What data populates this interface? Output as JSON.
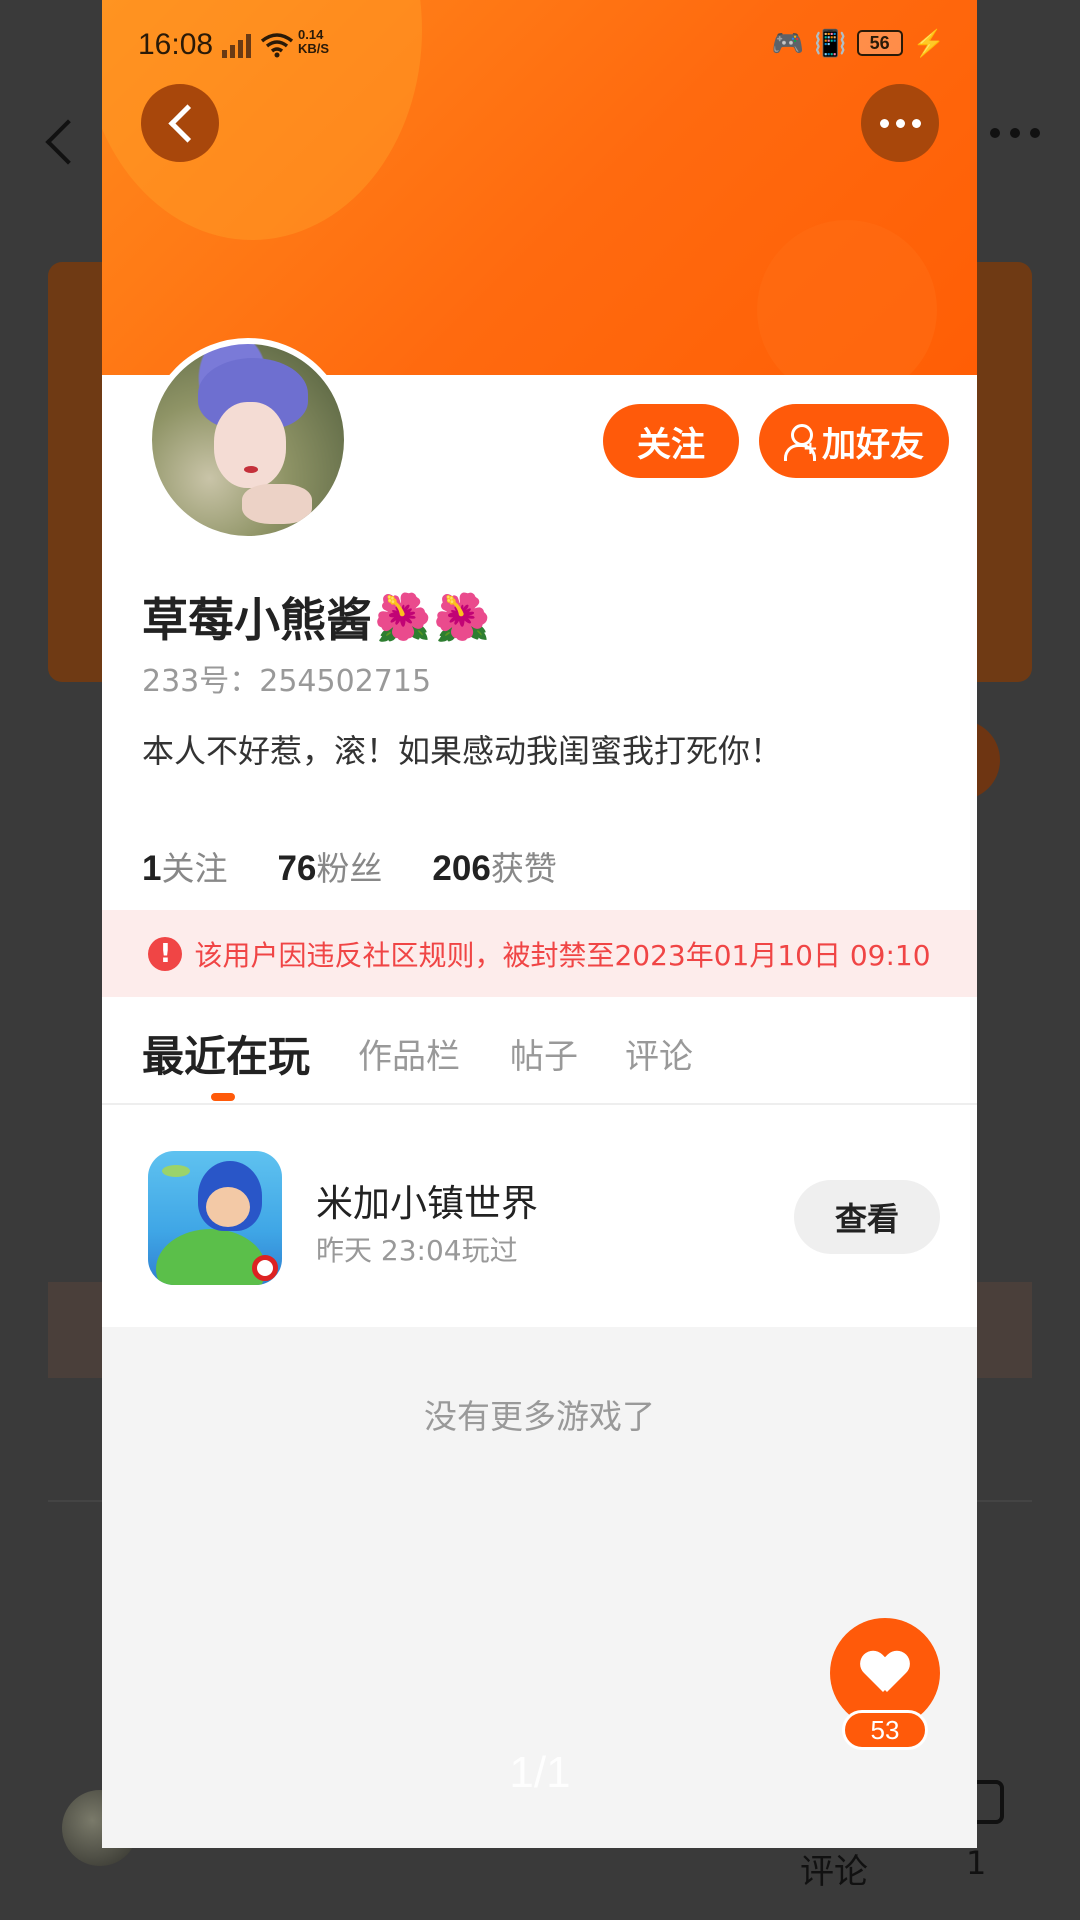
{
  "status_bar": {
    "time": "16:08",
    "net_speed_value": "0.14",
    "net_speed_unit": "KB/S",
    "battery": "56"
  },
  "profile": {
    "username": "草莓小熊酱",
    "flower_emoji": "🌺",
    "user_id": "233号：254502715",
    "bio": "本人不好惹，滚！如果感动我闺蜜我打死你！",
    "follow_button": "关注",
    "add_friend_button": "加好友",
    "stats": [
      {
        "value": "1",
        "label": "关注"
      },
      {
        "value": "76",
        "label": "粉丝"
      },
      {
        "value": "206",
        "label": "获赞"
      }
    ],
    "ban_notice": "该用户因违反社区规则，被封禁至2023年01月10日 09:10"
  },
  "tabs": [
    {
      "label": "最近在玩"
    },
    {
      "label": "作品栏"
    },
    {
      "label": "帖子"
    },
    {
      "label": "评论"
    }
  ],
  "recent_game": {
    "title": "米加小镇世界",
    "last_played": "昨天 23:04玩过",
    "view_button": "查看"
  },
  "no_more_text": "没有更多游戏了",
  "like_count": "53",
  "page_indicator": "1/1",
  "background": {
    "comment_label": "评论",
    "comment_count": "1"
  },
  "colors": {
    "accent": "#ff5a0a",
    "ban_red": "#f04545"
  }
}
